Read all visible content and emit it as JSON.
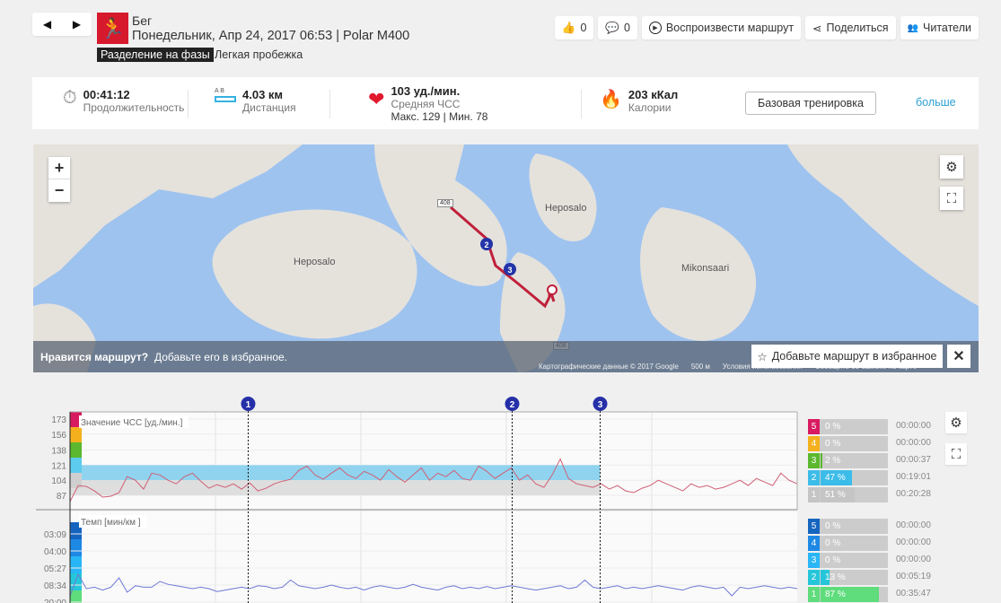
{
  "header": {
    "sport": "Бег",
    "datetime": "Понедельник, Апр 24, 2017 06:53 | Polar M400",
    "phase_tag": "Разделение на фазы",
    "phase_name": "Легкая пробежка"
  },
  "nav": {
    "prev": "◀",
    "next": "▶"
  },
  "actions": {
    "likes": "0",
    "comments": "0",
    "replay": "Воспроизвести маршрут",
    "share": "Поделиться",
    "followers": "Читатели"
  },
  "summary": {
    "duration": {
      "value": "00:41:12",
      "label": "Продолжительность"
    },
    "distance": {
      "ab": "A  B",
      "value": "4.03 км",
      "label": "Дистанция"
    },
    "hr": {
      "value": "103 уд./мин.",
      "label": "Средняя ЧСС",
      "minmax": "Макс. 129  |  Мин. 78"
    },
    "calories": {
      "value": "203 кКал",
      "label": "Калории"
    },
    "base_button": "Базовая тренировка",
    "more": "больше"
  },
  "map": {
    "zoom_in": "+",
    "zoom_out": "−",
    "labels": [
      "Heposalo",
      "Heposalo",
      "Mikonsaari",
      "408",
      "408"
    ],
    "banner_q": "Нравится маршрут?",
    "banner_text": "Добавьте его в избранное.",
    "fav_button": "Добавьте маршрут в избранное",
    "close": "✕",
    "attribution": "Картографические данные © 2017 Google",
    "scale": "500 м",
    "terms": "Условия использования",
    "report": "Сообщить об ошибке на карте",
    "markers": [
      "1",
      "2",
      "3"
    ]
  },
  "chart_data": {
    "type": "line",
    "markers": [
      {
        "label": "1",
        "x": 0.245
      },
      {
        "label": "2",
        "x": 0.608
      },
      {
        "label": "3",
        "x": 0.729
      }
    ],
    "hr": {
      "title": "Значение ЧСС [уд./мин.]",
      "ticks": [
        "173",
        "156",
        "138",
        "121",
        "104",
        "87"
      ],
      "ylim": [
        78,
        173
      ],
      "target_band": [
        104,
        121
      ],
      "values": [
        80,
        98,
        97,
        92,
        85,
        86,
        90,
        108,
        104,
        94,
        112,
        110,
        104,
        100,
        108,
        112,
        103,
        95,
        99,
        96,
        100,
        94,
        101,
        92,
        95,
        100,
        103,
        105,
        115,
        120,
        110,
        105,
        112,
        118,
        110,
        106,
        114,
        110,
        104,
        116,
        108,
        102,
        110,
        118,
        104,
        112,
        108,
        115,
        106,
        104,
        120,
        114,
        106,
        112,
        118,
        104,
        110,
        100,
        96,
        110,
        128,
        106,
        100,
        98,
        96,
        100,
        94,
        98,
        92,
        90,
        95,
        98,
        104,
        100,
        96,
        92,
        100,
        96,
        98,
        94,
        96,
        100,
        104,
        98,
        106,
        102,
        98,
        112,
        104,
        100
      ]
    },
    "pace": {
      "title": "Темп [мин/км ]",
      "ticks": [
        "03:09",
        "04:00",
        "05:27",
        "08:34",
        "20:00"
      ],
      "values": [
        0.6,
        0.9,
        0.7,
        0.72,
        0.68,
        0.72,
        0.85,
        0.65,
        0.74,
        0.72,
        0.72,
        0.8,
        0.76,
        0.74,
        0.72,
        0.7,
        0.72,
        0.7,
        0.66,
        0.68,
        0.7,
        0.72,
        0.7,
        0.74,
        0.73,
        0.7,
        0.72,
        0.82,
        0.74,
        0.72,
        0.7,
        0.72,
        0.75,
        0.72,
        0.7,
        0.72,
        0.68,
        0.72,
        0.74,
        0.72,
        0.7,
        0.72,
        0.76,
        0.72,
        0.7,
        0.68,
        0.72,
        0.74,
        0.7,
        0.72,
        0.7,
        0.73,
        0.7,
        0.72,
        0.74,
        0.72,
        0.7,
        0.68,
        0.7,
        0.72,
        0.74,
        0.7,
        0.72,
        0.82,
        0.72,
        0.7,
        0.72,
        0.74,
        0.7,
        0.72,
        0.7,
        0.72,
        0.74,
        0.72,
        0.7,
        0.68,
        0.72,
        0.74,
        0.72,
        0.7,
        0.72,
        0.6,
        0.72,
        0.7,
        0.72,
        0.74,
        0.72,
        0.7,
        0.72,
        0.7
      ]
    }
  },
  "hr_zones": [
    {
      "zone": "5",
      "pct": "0 %",
      "frac": 0,
      "time": "00:00:00",
      "color": "#d81b60"
    },
    {
      "zone": "4",
      "pct": "0 %",
      "frac": 0,
      "time": "00:00:00",
      "color": "#f5b11d"
    },
    {
      "zone": "3",
      "pct": "2 %",
      "frac": 0.02,
      "time": "00:00:37",
      "color": "#5cb82e"
    },
    {
      "zone": "2",
      "pct": "47 %",
      "frac": 0.47,
      "time": "00:19:01",
      "color": "#3cbce8"
    },
    {
      "zone": "1",
      "pct": "51 %",
      "frac": 0.51,
      "time": "00:20:28",
      "color": "#c5c5c5"
    }
  ],
  "pace_zones": [
    {
      "zone": "5",
      "pct": "0 %",
      "frac": 0,
      "time": "00:00:00",
      "color": "#1565c0"
    },
    {
      "zone": "4",
      "pct": "0 %",
      "frac": 0,
      "time": "00:00:00",
      "color": "#1e88e5"
    },
    {
      "zone": "3",
      "pct": "0 %",
      "frac": 0,
      "time": "00:00:00",
      "color": "#29b6f6"
    },
    {
      "zone": "2",
      "pct": "13 %",
      "frac": 0.13,
      "time": "00:05:19",
      "color": "#26c6da"
    },
    {
      "zone": "1",
      "pct": "87 %",
      "frac": 0.87,
      "time": "00:35:47",
      "color": "#5fdc7c"
    }
  ]
}
